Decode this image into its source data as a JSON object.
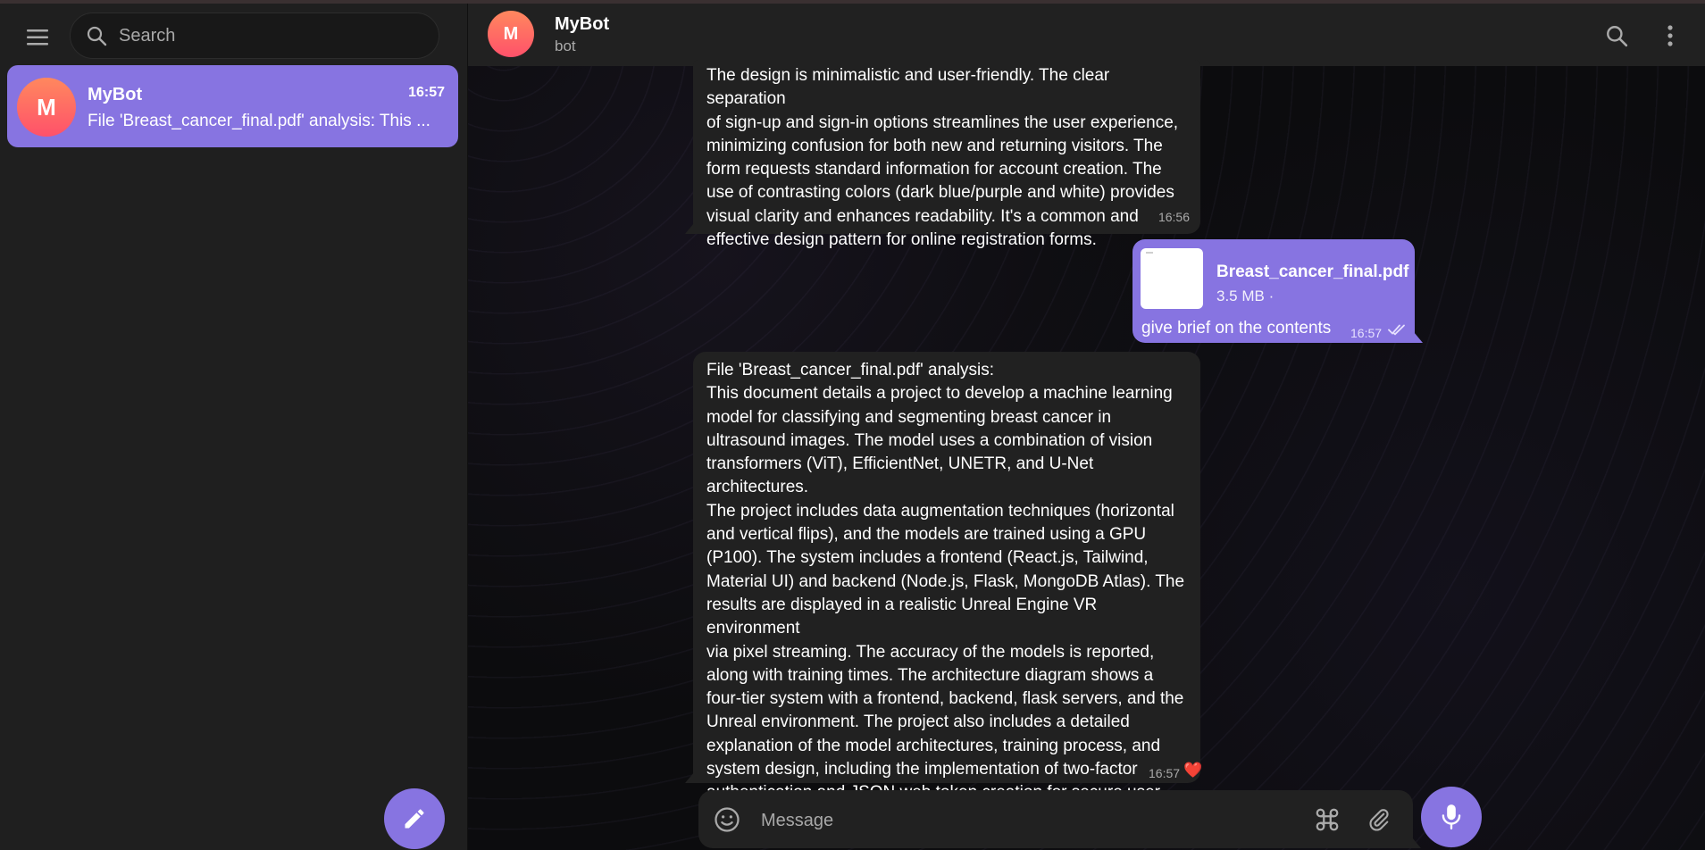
{
  "sidebar": {
    "search_placeholder": "Search",
    "chats": [
      {
        "avatar_letter": "M",
        "name": "MyBot",
        "time": "16:57",
        "preview": "File 'Breast_cancer_final.pdf' analysis: This ..."
      }
    ],
    "icons": {
      "menu": "hamburger-menu-icon",
      "search": "search-icon",
      "compose": "pencil-icon"
    }
  },
  "header": {
    "avatar_letter": "M",
    "title": "MyBot",
    "status": "bot",
    "icons": [
      "search-icon",
      "more-vertical-icon"
    ]
  },
  "messages": [
    {
      "direction": "incoming",
      "text": "The design is minimalistic and user-friendly. The clear separation\nof sign-up and sign-in options streamlines the user experience,\nminimizing confusion for both new and returning visitors.  The\nform requests standard information for account creation. The\nuse of contrasting colors (dark blue/purple and white) provides\nvisual clarity and enhances readability.  It's a common and\neffective design pattern for online registration forms.",
      "time": "16:56"
    },
    {
      "direction": "outgoing",
      "file_name": "Breast_cancer_final.pdf",
      "file_size": "3.5 MB ·",
      "caption": "give brief on the contents",
      "time": "16:57",
      "status_icon": "double-check-icon"
    },
    {
      "direction": "incoming",
      "text": "File 'Breast_cancer_final.pdf' analysis:\nThis document details a project to develop a machine learning\nmodel for classifying and segmenting breast cancer in\nultrasound images.  The model uses a combination of vision\ntransformers (ViT), EfficientNet, UNETR, and U-Net architectures.\nThe project includes data augmentation techniques (horizontal\nand vertical flips), and the models are trained using a GPU\n(P100).  The system includes a frontend (React.js, Tailwind,\nMaterial UI) and backend (Node.js, Flask, MongoDB Atlas).  The\nresults are displayed in a realistic Unreal Engine VR environment\nvia pixel streaming.  The accuracy of the models is reported,\nalong with training times.  The architecture diagram shows a\nfour-tier system with a frontend, backend, flask servers, and the\nUnreal environment. The project also includes a detailed\nexplanation of the model architectures, training process, and\nsystem design, including the implementation of two-factor\nauthentication and JSON web token creation for secure user\nlogin.",
      "time": "16:57",
      "reaction": "❤️"
    }
  ],
  "composer": {
    "placeholder": "Message",
    "icons": [
      "emoji-icon",
      "command-icon",
      "paperclip-icon",
      "microphone-icon"
    ]
  },
  "colors": {
    "accent": "#8774e1",
    "panel": "#212121",
    "sidebar": "#1f1f1f",
    "avatar_gradient_top": "#ff885e",
    "avatar_gradient_bottom": "#ff516a",
    "reaction": "#ff3b30"
  }
}
